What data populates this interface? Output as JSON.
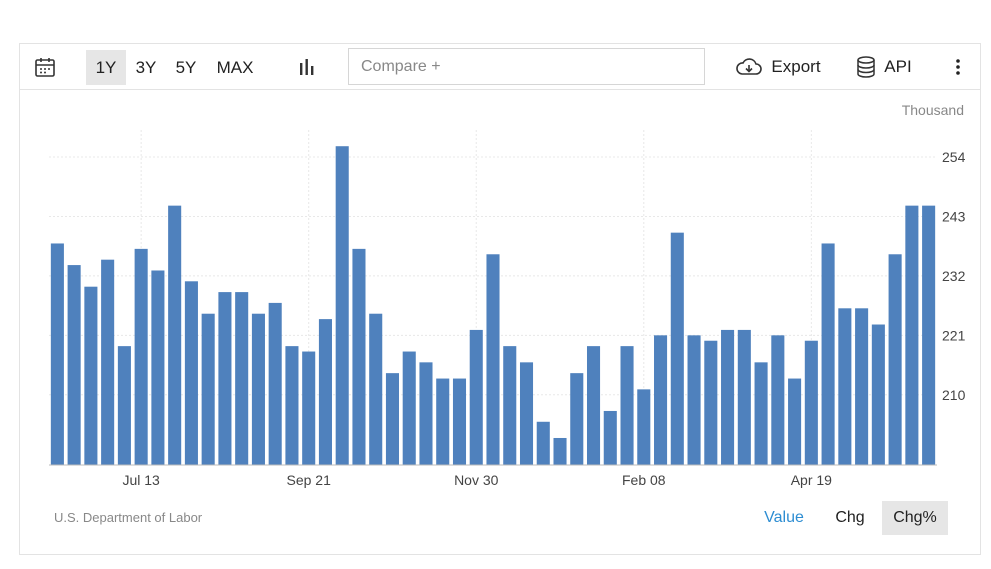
{
  "toolbar": {
    "calendar_icon": "calendar-icon",
    "ranges": [
      "1Y",
      "3Y",
      "5Y",
      "MAX"
    ],
    "active_range": "1Y",
    "chart_type_icon": "bar-chart-icon",
    "compare_placeholder": "Compare +",
    "export_label": "Export",
    "export_icon": "cloud-download-icon",
    "api_label": "API",
    "api_icon": "database-icon",
    "more_icon": "vertical-dots-icon"
  },
  "unit_label": "Thousand",
  "source_label": "U.S. Department of Labor",
  "modes": [
    "Value",
    "Chg",
    "Chg%"
  ],
  "active_mode": "Chg%",
  "colors": {
    "bar": "#4f81bd",
    "link": "#2d8dd2",
    "grid": "#e8e8e8"
  },
  "chart_data": {
    "type": "bar",
    "title": "",
    "xlabel": "",
    "ylabel": "",
    "ylim": [
      197,
      259
    ],
    "yticks": [
      210,
      221,
      232,
      243,
      254
    ],
    "xtick_labels": [
      {
        "label": "Jul 13",
        "index": 5
      },
      {
        "label": "Sep 21",
        "index": 15
      },
      {
        "label": "Nov 30",
        "index": 25
      },
      {
        "label": "Feb 08",
        "index": 35
      },
      {
        "label": "Apr 19",
        "index": 45
      }
    ],
    "grid": true,
    "values": [
      238,
      234,
      230,
      235,
      219,
      237,
      233,
      245,
      231,
      225,
      229,
      229,
      225,
      227,
      219,
      218,
      224,
      256,
      237,
      225,
      214,
      218,
      216,
      213,
      213,
      222,
      236,
      219,
      216,
      205,
      202,
      214,
      219,
      207,
      219,
      211,
      221,
      240,
      221,
      220,
      222,
      222,
      216,
      221,
      213,
      220,
      238,
      226,
      226,
      223,
      236,
      245,
      245
    ]
  }
}
